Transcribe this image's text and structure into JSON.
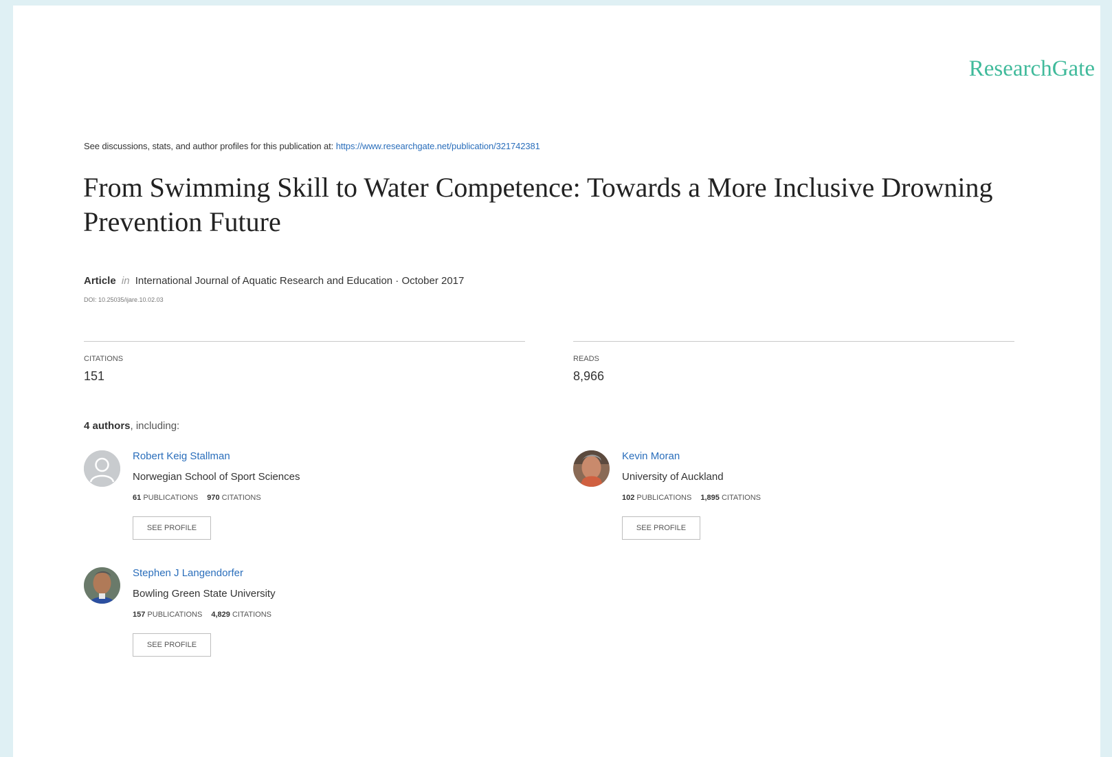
{
  "brand": {
    "logo_text": "ResearchGate",
    "color": "#40ba9b"
  },
  "intro": {
    "prefix": "See discussions, stats, and author profiles for this publication at: ",
    "url": "https://www.researchgate.net/publication/321742381"
  },
  "publication": {
    "title": "From Swimming Skill to Water Competence: Towards a More Inclusive Drowning Prevention Future",
    "type": "Article",
    "in_word": "in",
    "journal_date": "International Journal of Aquatic Research and Education · October 2017",
    "doi": "DOI: 10.25035/ijare.10.02.03"
  },
  "stats": {
    "citations_label": "Citations",
    "citations_value": "151",
    "reads_label": "Reads",
    "reads_value": "8,966"
  },
  "authors_heading": {
    "count": "4 authors",
    "suffix": ", including:"
  },
  "authors": [
    {
      "name": "Robert Keig Stallman",
      "institution": "Norwegian School of Sport Sciences",
      "publications": "61",
      "citations": "970",
      "avatar": "placeholder-avatar-icon"
    },
    {
      "name": "Kevin Moran",
      "institution": "University of Auckland",
      "publications": "102",
      "citations": "1,895",
      "avatar": "photo"
    },
    {
      "name": "Stephen J Langendorfer",
      "institution": "Bowling Green State University",
      "publications": "157",
      "citations": "4,829",
      "avatar": "photo"
    }
  ],
  "labels": {
    "publications": "Publications",
    "citations": "Citations",
    "see_profile": "See profile"
  }
}
